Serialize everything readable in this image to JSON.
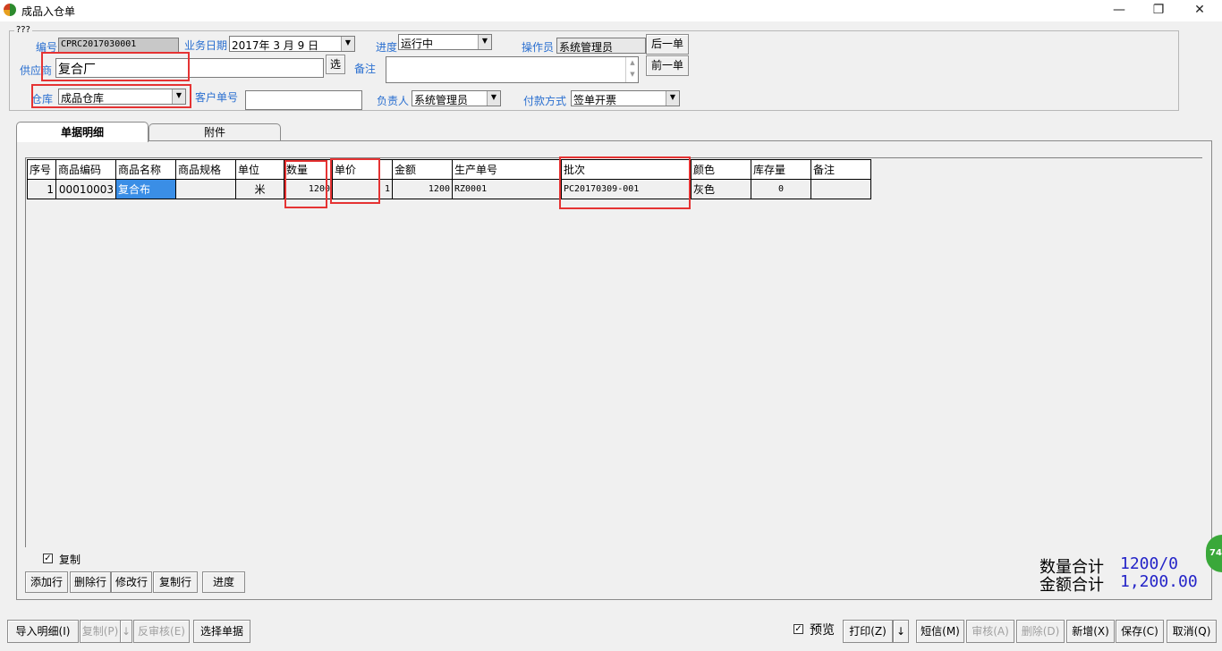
{
  "window": {
    "title": "成品入仓单",
    "minimize": "—",
    "maximize": "❐",
    "close": "✕"
  },
  "group_caption": "???",
  "header": {
    "code_label": "编号",
    "code_value": "CPRC2017030001",
    "date_label": "业务日期",
    "date_value": "2017年 3 月 9 日",
    "progress_label": "进度",
    "progress_value": "运行中",
    "operator_label": "操作员",
    "operator_value": "系统管理员",
    "next_button": "后一单",
    "prev_button": "前一单",
    "supplier_label": "供应商",
    "supplier_value": "复合厂",
    "select_button": "选",
    "remark_label": "备注",
    "remark_value": "",
    "warehouse_label": "仓库",
    "warehouse_value": "成品仓库",
    "customer_no_label": "客户单号",
    "customer_no_value": "",
    "manager_label": "负责人",
    "manager_value": "系统管理员",
    "payment_label": "付款方式",
    "payment_value": "签单开票"
  },
  "tabs": [
    {
      "label": "单据明细"
    },
    {
      "label": "附件"
    }
  ],
  "table": {
    "columns": [
      "序号",
      "商品编码",
      "商品名称",
      "商品规格",
      "单位",
      "数量",
      "单价",
      "金额",
      "生产单号",
      "批次",
      "颜色",
      "库存量",
      "备注"
    ],
    "rows": [
      {
        "seq": "1",
        "code": "00010003",
        "name": "复合布",
        "spec": "",
        "unit": "米",
        "qty": "1200",
        "price": "1",
        "amount": "1200",
        "prod_no": "RZ0001",
        "batch": "PC20170309-001",
        "color": "灰色",
        "stock": "0",
        "remark": ""
      }
    ]
  },
  "copy_checkbox": {
    "label": "复制",
    "checked": true,
    "mark": "✓"
  },
  "row_buttons": [
    "添加行",
    "删除行",
    "修改行",
    "复制行",
    "进度"
  ],
  "totals": {
    "qty_label": "数量合计",
    "qty_value": "1200/0",
    "amount_label": "金额合计",
    "amount_value": "1,200.00"
  },
  "badge": "74",
  "bottom_left_buttons": [
    {
      "label": "导入明细(I)",
      "enabled": true
    },
    {
      "label": "复制(P)",
      "enabled": false
    },
    {
      "label": "↓",
      "enabled": false
    },
    {
      "label": "反审核(E)",
      "enabled": false
    },
    {
      "label": "选择单据",
      "enabled": true
    }
  ],
  "preview_checkbox": {
    "label": "预览",
    "checked": true,
    "mark": "✓"
  },
  "bottom_right_buttons": [
    {
      "label": "打印(Z)",
      "enabled": true
    },
    {
      "label": "↓",
      "enabled": true
    },
    {
      "label": "短信(M)",
      "enabled": true
    },
    {
      "label": "审核(A)",
      "enabled": false
    },
    {
      "label": "删除(D)",
      "enabled": false
    },
    {
      "label": "新增(X)",
      "enabled": true
    },
    {
      "label": "保存(C)",
      "enabled": true
    },
    {
      "label": "取消(Q)",
      "enabled": true
    }
  ],
  "colors": {
    "label_blue": "#2a6fd0",
    "highlight_red": "#e53333",
    "selected_cell": "#3a8ee6",
    "total_value": "#2424c8"
  }
}
